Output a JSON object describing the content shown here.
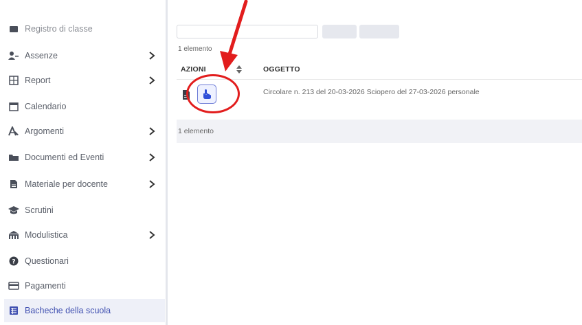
{
  "sidebar": {
    "items": [
      {
        "label": "Registro di classe",
        "icon": "register-icon",
        "chevron": false
      },
      {
        "label": "Assenze",
        "icon": "absences-icon",
        "chevron": true
      },
      {
        "label": "Report",
        "icon": "report-icon",
        "chevron": true
      },
      {
        "label": "Calendario",
        "icon": "calendar-icon",
        "chevron": false
      },
      {
        "label": "Argomenti",
        "icon": "topics-icon",
        "chevron": true
      },
      {
        "label": "Documenti ed Eventi",
        "icon": "folder-icon",
        "chevron": true
      },
      {
        "label": "Materiale per docente",
        "icon": "document-icon",
        "chevron": true
      },
      {
        "label": "Scrutini",
        "icon": "graduation-cap-icon",
        "chevron": false
      },
      {
        "label": "Modulistica",
        "icon": "building-icon",
        "chevron": true
      },
      {
        "label": "Questionari",
        "icon": "question-circle-icon",
        "chevron": false
      },
      {
        "label": "Pagamenti",
        "icon": "payment-card-icon",
        "chevron": false
      },
      {
        "label": "Bacheche della scuola",
        "icon": "board-list-icon",
        "chevron": false,
        "active": true
      }
    ]
  },
  "main": {
    "count_top": "1 elemento",
    "columns": {
      "azioni": "AZIONI",
      "oggetto": "OGGETTO"
    },
    "rows": [
      {
        "oggetto": "Circolare n. 213 del 20-03-2026 Sciopero del 27-03-2026 personale"
      }
    ],
    "count_bottom": "1 elemento"
  },
  "colors": {
    "accent": "#3f4fb0",
    "annotation": "#e21d1d",
    "active_bg": "#eef0f8"
  }
}
